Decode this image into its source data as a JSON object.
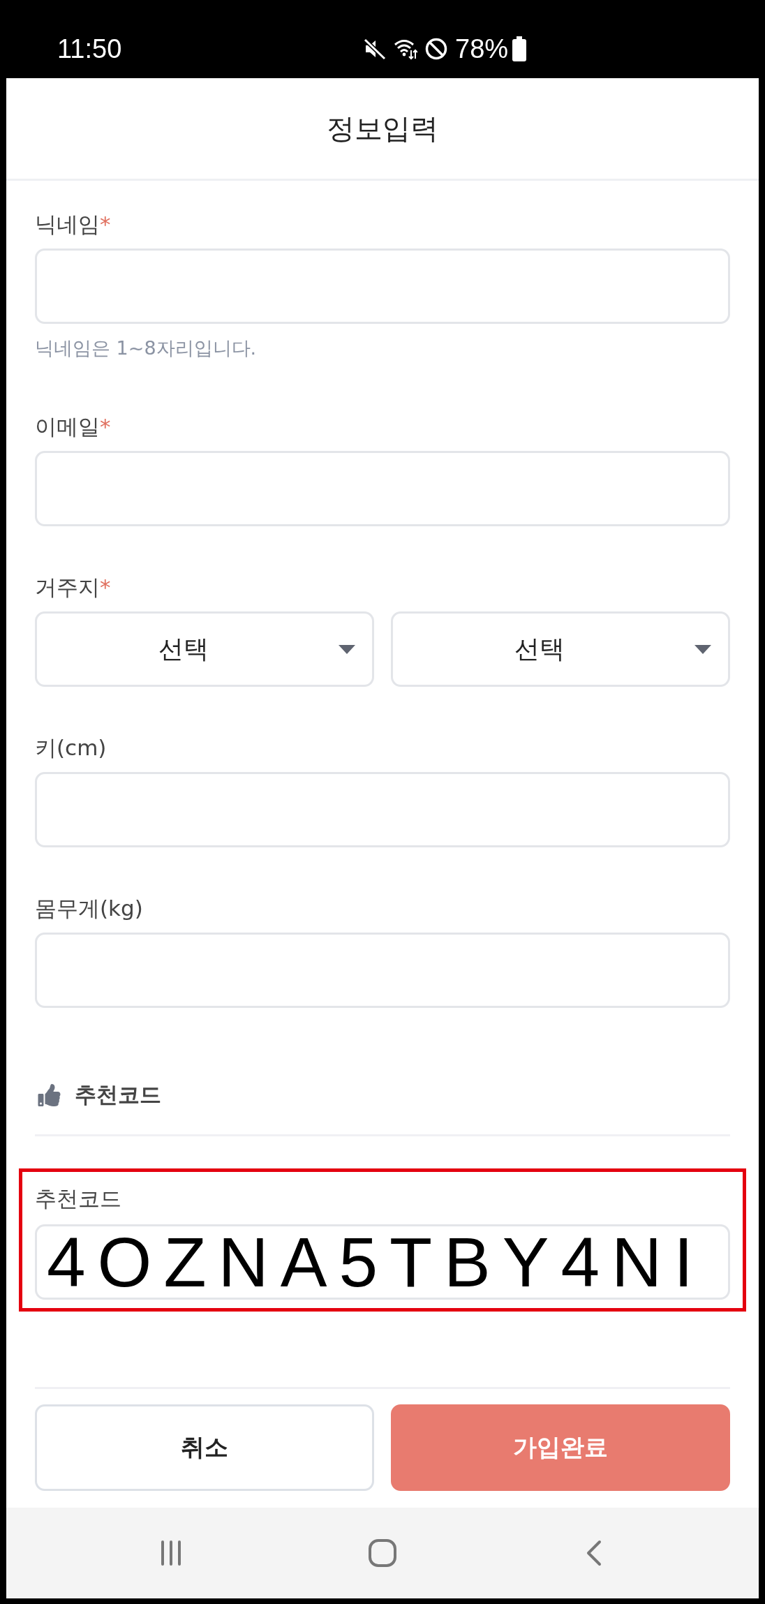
{
  "status_bar": {
    "time": "11:50",
    "battery": "78%"
  },
  "header": {
    "title": "정보입력"
  },
  "fields": [
    {
      "kind": "text",
      "label": "닉네임",
      "required_mark": "*",
      "hint": "닉네임은 1~8자리입니다."
    },
    {
      "kind": "text",
      "label": "이메일",
      "required_mark": "*"
    },
    {
      "kind": "select",
      "label": "거주지",
      "required_mark": "*",
      "options": [
        {
          "value": "선택"
        },
        {
          "value": "선택"
        }
      ]
    },
    {
      "kind": "text",
      "label": "키(cm)"
    },
    {
      "kind": "text",
      "label": "몸무게(kg)"
    }
  ],
  "referral": {
    "heading": "추천코드",
    "highlighted": true,
    "label": "추천코드",
    "value": "4OZNA5TBY4NI"
  },
  "buttons": [
    {
      "kind": "secondary",
      "label": "취소"
    },
    {
      "kind": "primary",
      "label": "가입완료"
    }
  ]
}
